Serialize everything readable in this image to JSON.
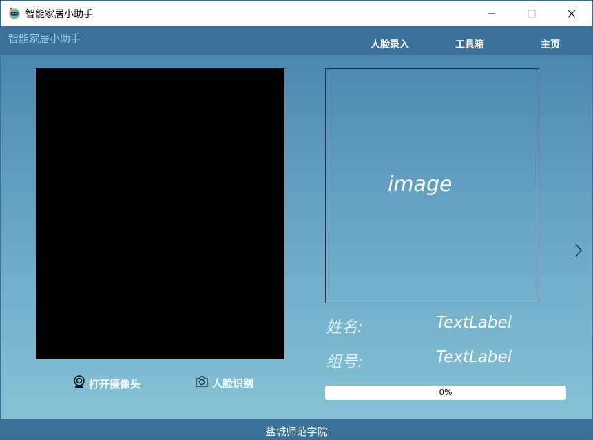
{
  "window": {
    "title": "智能家居小助手"
  },
  "header": {
    "brand": "智能家居小助手",
    "nav": [
      "人脸录入",
      "工具箱",
      "主页"
    ]
  },
  "main": {
    "image_placeholder": "image",
    "name_label": "姓名:",
    "name_value": "TextLabel",
    "group_label": "组号:",
    "group_value": "TextLabel",
    "progress": {
      "value": 0,
      "text": "0%"
    },
    "buttons": {
      "open_camera": "打开摄像头",
      "face_recognition": "人脸识别"
    }
  },
  "footer": {
    "text": "盐城师范学院"
  },
  "colors": {
    "header_bg": "#3b7099",
    "brand": "#8fd3ef",
    "camera_bg": "#000000"
  },
  "icons": {
    "app": "robot-icon",
    "camera": "webcam-icon",
    "photo": "camera-icon",
    "next": "chevron-right-icon"
  }
}
